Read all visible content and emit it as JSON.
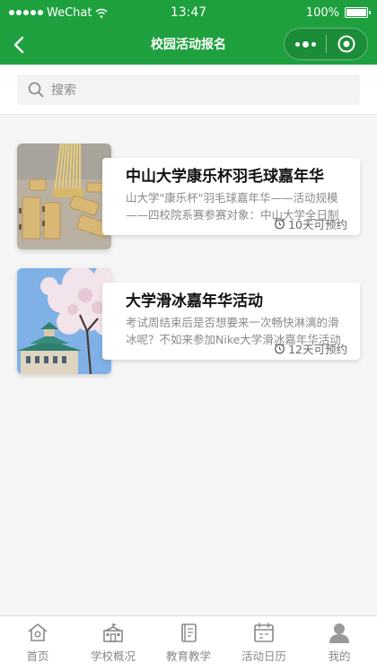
{
  "status_bar": {
    "carrier": "WeChat",
    "time": "13:47",
    "battery": "100%",
    "battery_level": 1.0
  },
  "nav": {
    "title": "校园活动报名",
    "back_icon": "chevron-left-icon",
    "menu_icon": "more-dots-icon",
    "close_icon": "target-close-icon"
  },
  "search": {
    "placeholder": "搜索",
    "icon": "search-icon"
  },
  "activities": [
    {
      "title": "中山大学康乐杯羽毛球嘉年华",
      "description": "山大学\"康乐杯\"羽毛球嘉年华——活动规模——四校院系赛参赛对象：中山大学全日制本科生",
      "booking": "10天可预约",
      "thumbnail": "library-interior"
    },
    {
      "title": "大学滑冰嘉年华活动",
      "description": "考试周结束后是否想要来一次畅快淋漓的滑冰呢？不如来参加Nike大学滑冰嘉年华活动吧",
      "booking": "12天可预约",
      "thumbnail": "cherry-blossom-campus"
    }
  ],
  "tab_bar": {
    "items": [
      {
        "label": "首页",
        "icon": "home-icon"
      },
      {
        "label": "学校概况",
        "icon": "school-building-icon"
      },
      {
        "label": "教育教学",
        "icon": "book-icon"
      },
      {
        "label": "活动日历",
        "icon": "calendar-icon"
      },
      {
        "label": "我的",
        "icon": "user-avatar-icon"
      }
    ]
  },
  "colors": {
    "brand": "#1fa03f",
    "background": "#f5f5f5",
    "tab_inactive": "#888888"
  }
}
